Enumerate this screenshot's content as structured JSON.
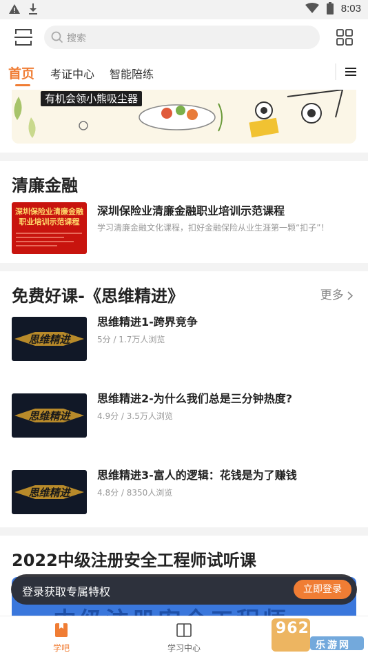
{
  "status_bar": {
    "time": "8:03"
  },
  "header": {
    "search_placeholder": "搜索"
  },
  "tabs": [
    {
      "label": "首页",
      "active": true
    },
    {
      "label": "考证中心",
      "active": false
    },
    {
      "label": "智能陪练",
      "active": false
    }
  ],
  "banner": {
    "tag": "有机会领小熊吸尘器"
  },
  "section_lianzheng": {
    "title": "清廉金融",
    "item": {
      "thumb_title": "深圳保险业清廉金融职业培训示范课程",
      "title": "深圳保险业清廉金融职业培训示范课程",
      "subtitle": "学习清廉金融文化课程，扣好金融保险从业生涯第一颗“扣子”！"
    }
  },
  "section_free": {
    "title": "免费好课-《思维精进》",
    "more": "更多",
    "thumb_text": "思维精进",
    "items": [
      {
        "title": "思维精进1-跨界竞争",
        "meta": "5分 / 1.7万人浏览"
      },
      {
        "title": "思维精进2-为什么我们总是三分钟热度?",
        "meta": "4.9分 / 3.5万人浏览"
      },
      {
        "title": "思维精进3-富人的逻辑：花钱是为了赚钱",
        "meta": "4.8分 / 8350人浏览"
      }
    ]
  },
  "section_2022": {
    "title": "2022中级注册安全工程师试听课",
    "banner_text": "中级注册安全工程师"
  },
  "login_bar": {
    "text": "登录获取专属特权",
    "button": "立即登录"
  },
  "bottom_nav": [
    {
      "label": "学吧",
      "icon": "bookmark-icon",
      "active": true
    },
    {
      "label": "学习中心",
      "icon": "book-icon",
      "active": false
    }
  ],
  "watermark": {
    "text": "962.NET",
    "sub": "乐游网"
  },
  "colors": {
    "accent": "#f07d34",
    "text": "#222222",
    "muted": "#999999",
    "separator": "#f3f3f3"
  }
}
